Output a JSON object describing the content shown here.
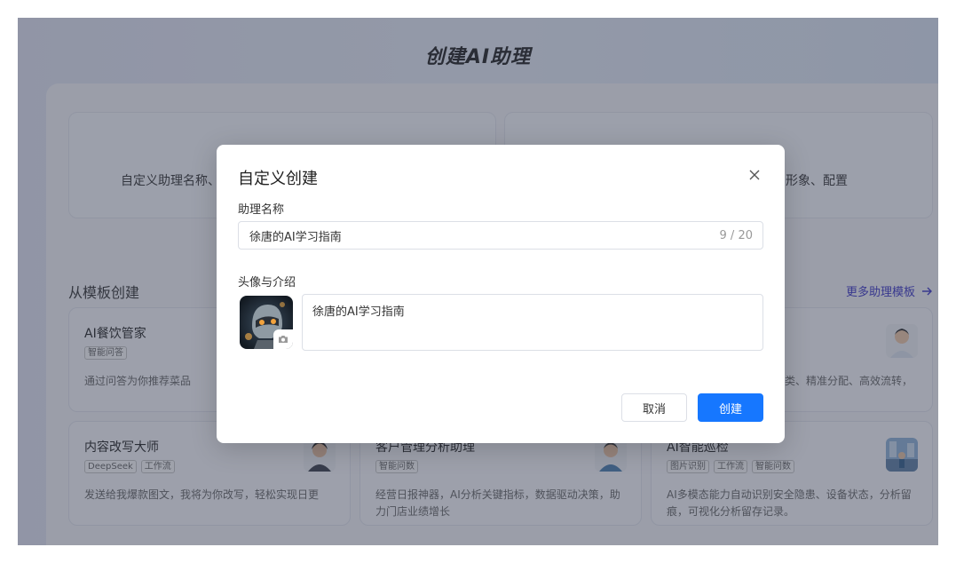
{
  "page": {
    "title": "创建AI助理"
  },
  "top_cards": {
    "left_text": "自定义助理名称、",
    "right_text": "形象、配置"
  },
  "templates_section": {
    "title": "从模板创建",
    "more_link": "更多助理模板"
  },
  "templates": [
    {
      "name": "AI餐饮管家",
      "tags": [
        "智能问答"
      ],
      "desc": "通过问答为你推荐菜品",
      "avatar": "robot-avatar"
    },
    {
      "name": "",
      "tags": [],
      "desc": "类、精准分配、高效流转，",
      "avatar": "person-avatar"
    },
    {
      "name": "内容改写大师",
      "tags": [
        "DeepSeek",
        "工作流"
      ],
      "desc": "发送给我爆款图文，我将为你改写，轻松实现日更",
      "avatar": "person-avatar"
    },
    {
      "name": "客户管理分析助理",
      "tags": [
        "智能问数"
      ],
      "desc": "经营日报神器，AI分析关键指标，数据驱动决策，助力门店业绩增长",
      "avatar": "person-avatar"
    },
    {
      "name": "AI智能巡检",
      "tags": [
        "图片识别",
        "工作流",
        "智能问数"
      ],
      "desc": "AI多模态能力自动识别安全隐患、设备状态，分析留痕，可视化分析留存记录。",
      "avatar": "scene-avatar"
    }
  ],
  "modal": {
    "title": "自定义创建",
    "name_label": "助理名称",
    "name_value": "徐唐的AI学习指南",
    "name_count": "9 / 20",
    "avatar_label": "头像与介绍",
    "intro_value": "徐唐的AI学习指南",
    "cancel_label": "取消",
    "create_label": "创建"
  },
  "colors": {
    "primary": "#1677ff",
    "link": "#3b35c8",
    "overlay": "rgba(55,60,80,0.48)"
  },
  "icons": {
    "close": "close-icon",
    "camera": "camera-icon",
    "arrow": "arrow-right-icon"
  }
}
